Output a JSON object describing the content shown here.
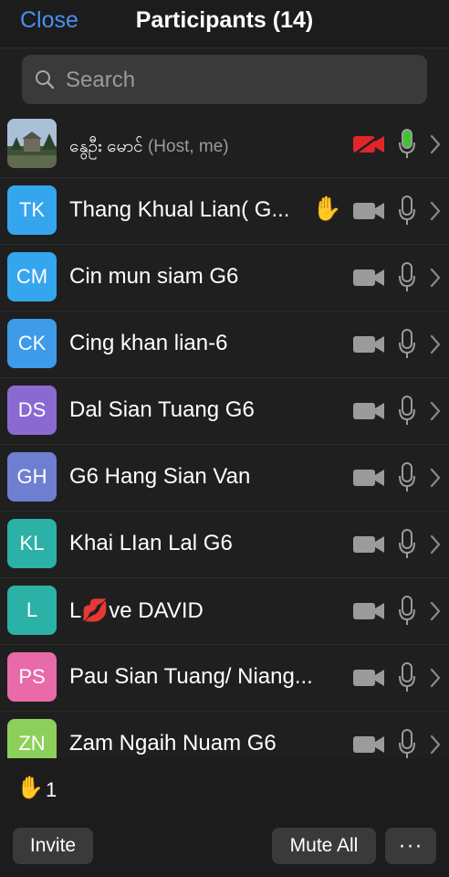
{
  "header": {
    "close_label": "Close",
    "title": "Participants (14)"
  },
  "search": {
    "placeholder": "Search"
  },
  "participants": [
    {
      "initials": "",
      "name": "နွေဦး မောင်",
      "suffix": "(Host, me)",
      "avatar_color": "",
      "video": "off-red",
      "mic": "on-green",
      "hand": false
    },
    {
      "initials": "TK",
      "name": "Thang Khual Lian( G...",
      "suffix": "",
      "avatar_color": "#35a6ee",
      "video": "on",
      "mic": "muted",
      "hand": true
    },
    {
      "initials": "CM",
      "name": "Cin mun siam G6",
      "suffix": "",
      "avatar_color": "#35a6ee",
      "video": "on",
      "mic": "muted",
      "hand": false
    },
    {
      "initials": "CK",
      "name": "Cing khan lian-6",
      "suffix": "",
      "avatar_color": "#3d9be9",
      "video": "on",
      "mic": "muted",
      "hand": false
    },
    {
      "initials": "DS",
      "name": "Dal Sian Tuang G6",
      "suffix": "",
      "avatar_color": "#8a6ad1",
      "video": "on",
      "mic": "muted",
      "hand": false
    },
    {
      "initials": "GH",
      "name": "G6 Hang Sian Van",
      "suffix": "",
      "avatar_color": "#6e7fd1",
      "video": "on",
      "mic": "muted",
      "hand": false
    },
    {
      "initials": "KL",
      "name": "Khai LIan Lal G6",
      "suffix": "",
      "avatar_color": "#2bb1a6",
      "video": "on",
      "mic": "muted",
      "hand": false
    },
    {
      "initials": "L",
      "name": "L💋ve DAVID",
      "suffix": "",
      "avatar_color": "#2bb1a6",
      "video": "on",
      "mic": "muted",
      "hand": false
    },
    {
      "initials": "PS",
      "name": "Pau Sian Tuang/ Niang...",
      "suffix": "",
      "avatar_color": "#e86aa9",
      "video": "on",
      "mic": "muted",
      "hand": false
    },
    {
      "initials": "ZN",
      "name": "Zam Ngaih Nuam G6",
      "suffix": "",
      "avatar_color": "#8ccf5a",
      "video": "on",
      "mic": "muted",
      "hand": false
    }
  ],
  "raised_hands": {
    "icon": "raised-hand-icon",
    "count": "1"
  },
  "footer": {
    "invite_label": "Invite",
    "mute_all_label": "Mute All",
    "more_label": "···"
  },
  "colors": {
    "accent": "#4a8ff0",
    "video_off": "#e0262a",
    "mic_on": "#3ec431"
  }
}
